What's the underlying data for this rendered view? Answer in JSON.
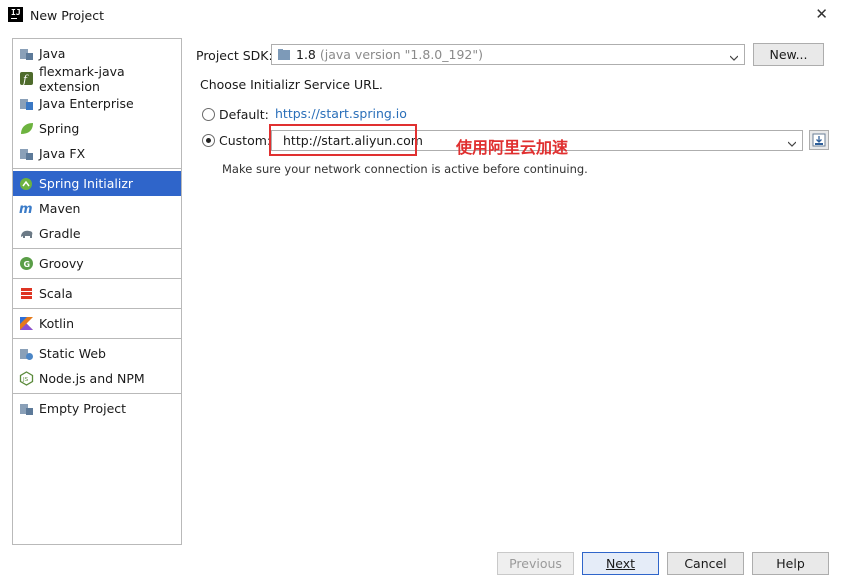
{
  "window": {
    "title": "New Project"
  },
  "sidebar": {
    "groups": [
      [
        {
          "label": "Java",
          "icon": "folder-icon"
        },
        {
          "label": "flexmark-java extension",
          "icon": "flexmark-icon"
        },
        {
          "label": "Java Enterprise",
          "icon": "java-enterprise-icon"
        },
        {
          "label": "Spring",
          "icon": "spring-leaf-icon"
        },
        {
          "label": "Java FX",
          "icon": "folder-icon"
        }
      ],
      [
        {
          "label": "Spring Initializr",
          "icon": "spring-initializr-icon",
          "selected": true
        },
        {
          "label": "Maven",
          "icon": "maven-icon"
        },
        {
          "label": "Gradle",
          "icon": "gradle-elephant-icon"
        }
      ],
      [
        {
          "label": "Groovy",
          "icon": "groovy-icon"
        }
      ],
      [
        {
          "label": "Scala",
          "icon": "scala-icon"
        }
      ],
      [
        {
          "label": "Kotlin",
          "icon": "kotlin-icon"
        }
      ],
      [
        {
          "label": "Static Web",
          "icon": "static-web-icon"
        },
        {
          "label": "Node.js and NPM",
          "icon": "nodejs-icon"
        }
      ],
      [
        {
          "label": "Empty Project",
          "icon": "folder-icon"
        }
      ]
    ]
  },
  "main": {
    "sdk_label": "Project SDK:",
    "sdk_value": "1.8",
    "sdk_detail": "(java version \"1.8.0_192\")",
    "new_button": "New...",
    "choose_text": "Choose Initializr Service URL.",
    "default_label": "Default:",
    "default_url": "https://start.spring.io",
    "custom_label": "Custom:",
    "custom_value": "http://start.aliyun.com",
    "hint": "Make sure your network connection is active before continuing.",
    "annotation": "使用阿里云加速"
  },
  "buttons": {
    "previous": "Previous",
    "next": "Next",
    "cancel": "Cancel",
    "help": "Help"
  },
  "colors": {
    "selection": "#2f65ca",
    "link": "#2a6fb9",
    "annotation": "#e03030"
  }
}
